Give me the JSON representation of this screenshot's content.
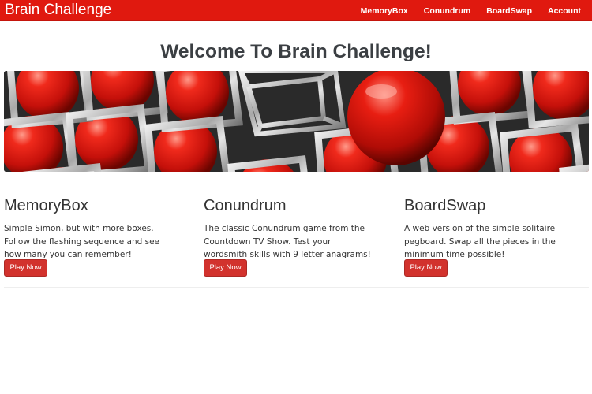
{
  "navbar": {
    "brand": "Brain Challenge",
    "links": [
      "MemoryBox",
      "Conundrum",
      "BoardSwap",
      "Account"
    ]
  },
  "main": {
    "title": "Welcome To Brain Challenge!",
    "hero_image": "red-spheres-chrome-grid",
    "games": [
      {
        "name": "MemoryBox",
        "description": "Simple Simon, but with more boxes. Follow the flashing sequence and see how many you can remember!",
        "button": "Play Now"
      },
      {
        "name": "Conundrum",
        "description": "The classic Conundrum game from the Countdown TV Show. Test your wordsmith skills with 9 letter anagrams!",
        "button": "Play Now"
      },
      {
        "name": "BoardSwap",
        "description": "A web version of the simple solitaire pegboard. Swap all the pieces in the minimum time possible!",
        "button": "Play Now"
      }
    ]
  },
  "colors": {
    "navbar": "#e0190f",
    "button": "#d2322d",
    "title": "#3b3f43"
  }
}
